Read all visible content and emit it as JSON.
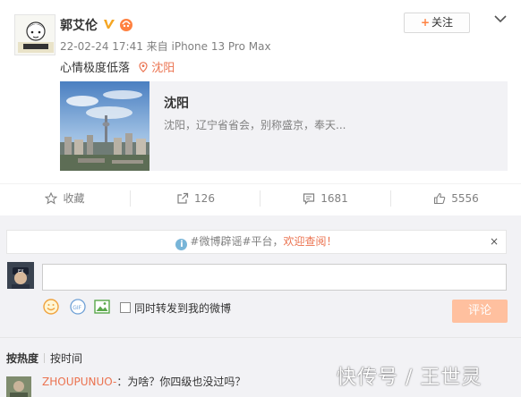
{
  "post": {
    "author": "郭艾伦",
    "meta": "22-02-24 17:41 来自 iPhone 13 Pro Max",
    "follow_label": "关注",
    "text": "心情极度低落",
    "location": "沈阳",
    "card": {
      "title": "沈阳",
      "description": "沈阳，辽宁省省会，别称盛京，奉天..."
    }
  },
  "actions": {
    "favorite": "收藏",
    "repost_count": "126",
    "comment_count": "1681",
    "like_count": "5556"
  },
  "comments": {
    "notice_hashtag": "#微博辟谣#平台，",
    "notice_welcome": "欢迎查阅！",
    "notice_close": "×",
    "repost_checkbox_label": "同时转发到我的微博",
    "submit_label": "评论",
    "sort_hot": "按热度",
    "sort_time": "按时间",
    "first_comment": {
      "user": "ZHOUPUNUO-",
      "text": "：为啥？你四级也没过吗？"
    }
  },
  "watermark": "快传号 / 王世灵",
  "colors": {
    "accent_orange": "#eb7350",
    "submit_disabled": "#ffc09f",
    "panel_bg": "#f2f2f5"
  }
}
